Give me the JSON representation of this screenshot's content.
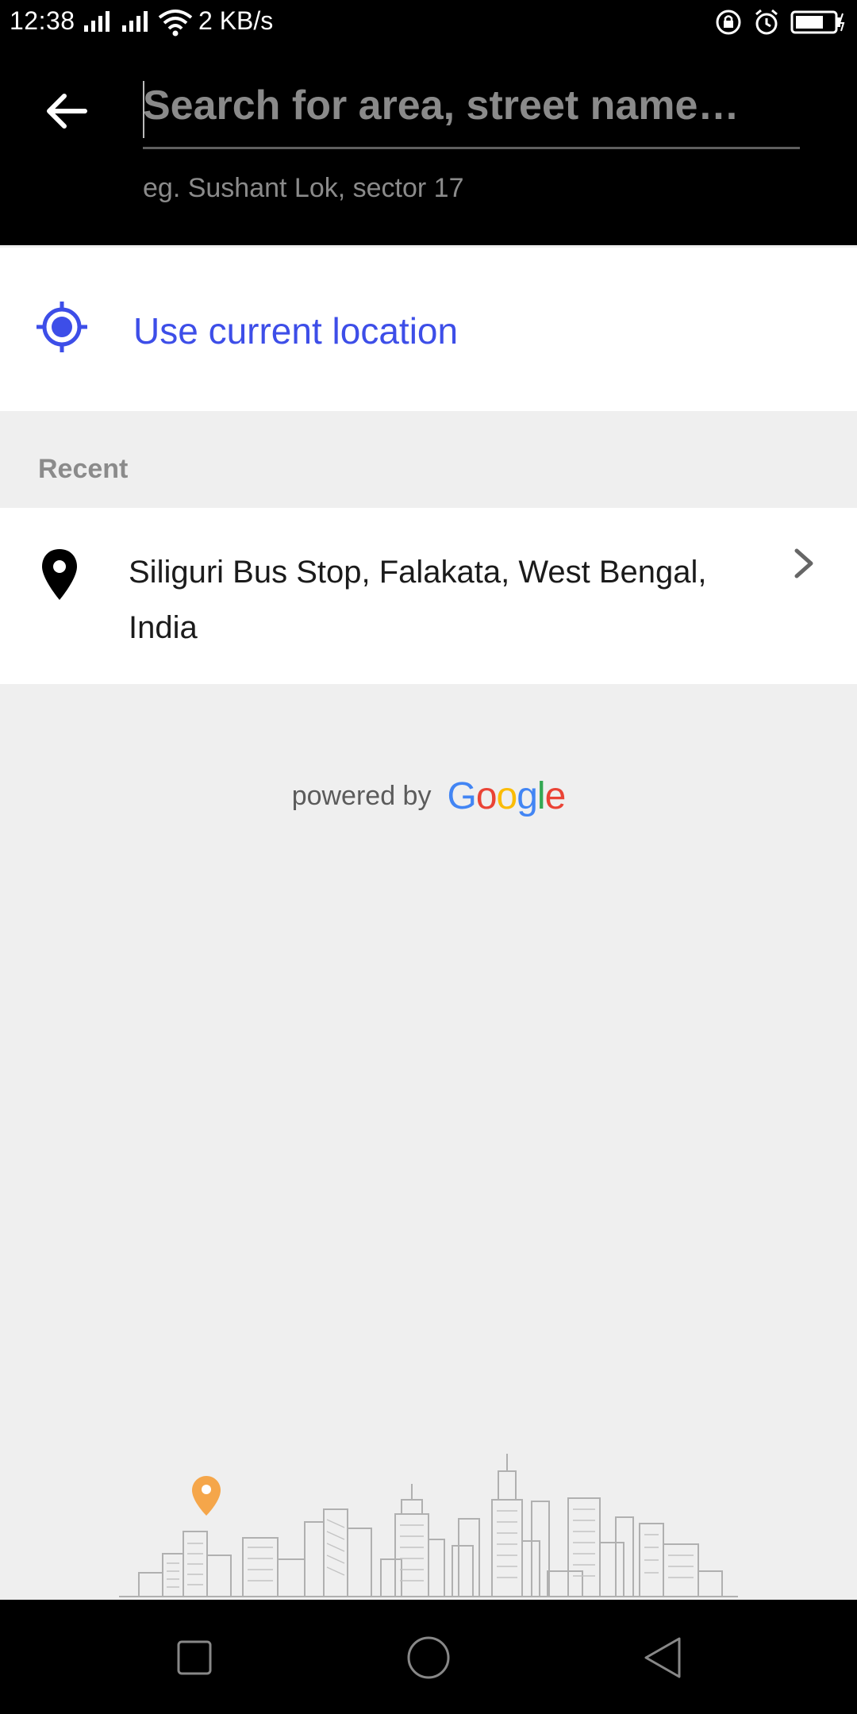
{
  "status_bar": {
    "time": "12:38",
    "network_speed": "2 KB/s",
    "icons": [
      "signal-icon",
      "signal-icon",
      "wifi-icon",
      "lock-rotation-icon",
      "alarm-icon",
      "battery-icon"
    ]
  },
  "header": {
    "search_placeholder": "Search for area, street name…",
    "search_value": "",
    "hint": "eg. Sushant Lok, sector 17"
  },
  "current_location": {
    "label": "Use current location",
    "icon": "gps-target-icon",
    "color": "#3d4ee8"
  },
  "recent": {
    "header": "Recent",
    "items": [
      {
        "label": "Siliguri Bus Stop, Falakata, West Bengal, India",
        "icon": "map-pin-icon"
      }
    ]
  },
  "footer": {
    "powered_by": "powered by",
    "brand": "Google"
  },
  "nav_bar": {
    "buttons": [
      "recents-square-icon",
      "home-circle-icon",
      "back-triangle-icon"
    ]
  },
  "colors": {
    "header_bg": "#000000",
    "accent": "#3d4ee8",
    "page_bg": "#efefef",
    "illustration_pin": "#f5a64a"
  }
}
